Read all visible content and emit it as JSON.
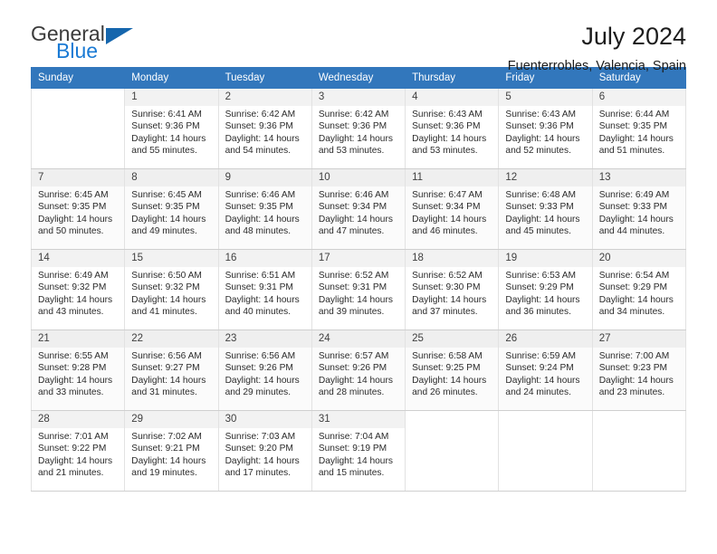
{
  "brand": {
    "line1": "General",
    "line2": "Blue",
    "accent_blue": "#1a7ad4",
    "triangle_blue": "#1566ad"
  },
  "header": {
    "title": "July 2024",
    "subtitle": "Fuenterrobles, Valencia, Spain"
  },
  "calendar": {
    "header_bg": "#3277bc",
    "weekdays": [
      "Sunday",
      "Monday",
      "Tuesday",
      "Wednesday",
      "Thursday",
      "Friday",
      "Saturday"
    ],
    "weeks": [
      [
        {
          "day": "",
          "sunrise": "",
          "sunset": "",
          "daylight1": "",
          "daylight2": ""
        },
        {
          "day": "1",
          "sunrise": "Sunrise: 6:41 AM",
          "sunset": "Sunset: 9:36 PM",
          "daylight1": "Daylight: 14 hours",
          "daylight2": "and 55 minutes."
        },
        {
          "day": "2",
          "sunrise": "Sunrise: 6:42 AM",
          "sunset": "Sunset: 9:36 PM",
          "daylight1": "Daylight: 14 hours",
          "daylight2": "and 54 minutes."
        },
        {
          "day": "3",
          "sunrise": "Sunrise: 6:42 AM",
          "sunset": "Sunset: 9:36 PM",
          "daylight1": "Daylight: 14 hours",
          "daylight2": "and 53 minutes."
        },
        {
          "day": "4",
          "sunrise": "Sunrise: 6:43 AM",
          "sunset": "Sunset: 9:36 PM",
          "daylight1": "Daylight: 14 hours",
          "daylight2": "and 53 minutes."
        },
        {
          "day": "5",
          "sunrise": "Sunrise: 6:43 AM",
          "sunset": "Sunset: 9:36 PM",
          "daylight1": "Daylight: 14 hours",
          "daylight2": "and 52 minutes."
        },
        {
          "day": "6",
          "sunrise": "Sunrise: 6:44 AM",
          "sunset": "Sunset: 9:35 PM",
          "daylight1": "Daylight: 14 hours",
          "daylight2": "and 51 minutes."
        }
      ],
      [
        {
          "day": "7",
          "sunrise": "Sunrise: 6:45 AM",
          "sunset": "Sunset: 9:35 PM",
          "daylight1": "Daylight: 14 hours",
          "daylight2": "and 50 minutes."
        },
        {
          "day": "8",
          "sunrise": "Sunrise: 6:45 AM",
          "sunset": "Sunset: 9:35 PM",
          "daylight1": "Daylight: 14 hours",
          "daylight2": "and 49 minutes."
        },
        {
          "day": "9",
          "sunrise": "Sunrise: 6:46 AM",
          "sunset": "Sunset: 9:35 PM",
          "daylight1": "Daylight: 14 hours",
          "daylight2": "and 48 minutes."
        },
        {
          "day": "10",
          "sunrise": "Sunrise: 6:46 AM",
          "sunset": "Sunset: 9:34 PM",
          "daylight1": "Daylight: 14 hours",
          "daylight2": "and 47 minutes."
        },
        {
          "day": "11",
          "sunrise": "Sunrise: 6:47 AM",
          "sunset": "Sunset: 9:34 PM",
          "daylight1": "Daylight: 14 hours",
          "daylight2": "and 46 minutes."
        },
        {
          "day": "12",
          "sunrise": "Sunrise: 6:48 AM",
          "sunset": "Sunset: 9:33 PM",
          "daylight1": "Daylight: 14 hours",
          "daylight2": "and 45 minutes."
        },
        {
          "day": "13",
          "sunrise": "Sunrise: 6:49 AM",
          "sunset": "Sunset: 9:33 PM",
          "daylight1": "Daylight: 14 hours",
          "daylight2": "and 44 minutes."
        }
      ],
      [
        {
          "day": "14",
          "sunrise": "Sunrise: 6:49 AM",
          "sunset": "Sunset: 9:32 PM",
          "daylight1": "Daylight: 14 hours",
          "daylight2": "and 43 minutes."
        },
        {
          "day": "15",
          "sunrise": "Sunrise: 6:50 AM",
          "sunset": "Sunset: 9:32 PM",
          "daylight1": "Daylight: 14 hours",
          "daylight2": "and 41 minutes."
        },
        {
          "day": "16",
          "sunrise": "Sunrise: 6:51 AM",
          "sunset": "Sunset: 9:31 PM",
          "daylight1": "Daylight: 14 hours",
          "daylight2": "and 40 minutes."
        },
        {
          "day": "17",
          "sunrise": "Sunrise: 6:52 AM",
          "sunset": "Sunset: 9:31 PM",
          "daylight1": "Daylight: 14 hours",
          "daylight2": "and 39 minutes."
        },
        {
          "day": "18",
          "sunrise": "Sunrise: 6:52 AM",
          "sunset": "Sunset: 9:30 PM",
          "daylight1": "Daylight: 14 hours",
          "daylight2": "and 37 minutes."
        },
        {
          "day": "19",
          "sunrise": "Sunrise: 6:53 AM",
          "sunset": "Sunset: 9:29 PM",
          "daylight1": "Daylight: 14 hours",
          "daylight2": "and 36 minutes."
        },
        {
          "day": "20",
          "sunrise": "Sunrise: 6:54 AM",
          "sunset": "Sunset: 9:29 PM",
          "daylight1": "Daylight: 14 hours",
          "daylight2": "and 34 minutes."
        }
      ],
      [
        {
          "day": "21",
          "sunrise": "Sunrise: 6:55 AM",
          "sunset": "Sunset: 9:28 PM",
          "daylight1": "Daylight: 14 hours",
          "daylight2": "and 33 minutes."
        },
        {
          "day": "22",
          "sunrise": "Sunrise: 6:56 AM",
          "sunset": "Sunset: 9:27 PM",
          "daylight1": "Daylight: 14 hours",
          "daylight2": "and 31 minutes."
        },
        {
          "day": "23",
          "sunrise": "Sunrise: 6:56 AM",
          "sunset": "Sunset: 9:26 PM",
          "daylight1": "Daylight: 14 hours",
          "daylight2": "and 29 minutes."
        },
        {
          "day": "24",
          "sunrise": "Sunrise: 6:57 AM",
          "sunset": "Sunset: 9:26 PM",
          "daylight1": "Daylight: 14 hours",
          "daylight2": "and 28 minutes."
        },
        {
          "day": "25",
          "sunrise": "Sunrise: 6:58 AM",
          "sunset": "Sunset: 9:25 PM",
          "daylight1": "Daylight: 14 hours",
          "daylight2": "and 26 minutes."
        },
        {
          "day": "26",
          "sunrise": "Sunrise: 6:59 AM",
          "sunset": "Sunset: 9:24 PM",
          "daylight1": "Daylight: 14 hours",
          "daylight2": "and 24 minutes."
        },
        {
          "day": "27",
          "sunrise": "Sunrise: 7:00 AM",
          "sunset": "Sunset: 9:23 PM",
          "daylight1": "Daylight: 14 hours",
          "daylight2": "and 23 minutes."
        }
      ],
      [
        {
          "day": "28",
          "sunrise": "Sunrise: 7:01 AM",
          "sunset": "Sunset: 9:22 PM",
          "daylight1": "Daylight: 14 hours",
          "daylight2": "and 21 minutes."
        },
        {
          "day": "29",
          "sunrise": "Sunrise: 7:02 AM",
          "sunset": "Sunset: 9:21 PM",
          "daylight1": "Daylight: 14 hours",
          "daylight2": "and 19 minutes."
        },
        {
          "day": "30",
          "sunrise": "Sunrise: 7:03 AM",
          "sunset": "Sunset: 9:20 PM",
          "daylight1": "Daylight: 14 hours",
          "daylight2": "and 17 minutes."
        },
        {
          "day": "31",
          "sunrise": "Sunrise: 7:04 AM",
          "sunset": "Sunset: 9:19 PM",
          "daylight1": "Daylight: 14 hours",
          "daylight2": "and 15 minutes."
        },
        {
          "day": "",
          "sunrise": "",
          "sunset": "",
          "daylight1": "",
          "daylight2": ""
        },
        {
          "day": "",
          "sunrise": "",
          "sunset": "",
          "daylight1": "",
          "daylight2": ""
        },
        {
          "day": "",
          "sunrise": "",
          "sunset": "",
          "daylight1": "",
          "daylight2": ""
        }
      ]
    ]
  }
}
